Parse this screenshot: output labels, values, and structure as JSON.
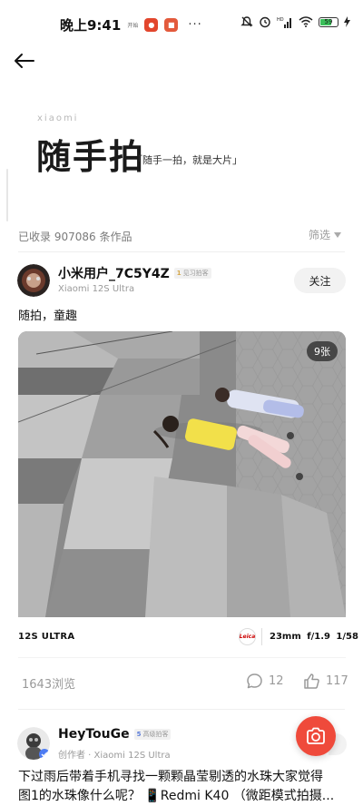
{
  "status_bar": {
    "time": "晚上9:41",
    "mini_tag": "开始",
    "more": "···",
    "network_label": "HD",
    "battery": "59",
    "colors": {
      "battery_fill": "#3bbf5a",
      "app1": "#e2462d",
      "app2": "#e35a3c"
    }
  },
  "header": {
    "brand": "xiaomi",
    "title": "随手拍",
    "slogan": "「随手一拍，就是大片」"
  },
  "toolbar": {
    "count_text": "已收录 907086 条作品",
    "filter_label": "筛选"
  },
  "post1": {
    "username": "小米用户_7C5Y4Z",
    "badge_level": "1",
    "badge_text": "见习拍客",
    "device": "Xiaomi 12S Ultra",
    "follow_label": "关注",
    "caption": "随拍，童趣",
    "photo_count": "9张",
    "exif_model": "12S ULTRA",
    "leica": "Leica",
    "exif_params": "23mm  f/1.9  1/58",
    "views": "1643浏览",
    "comments": "12",
    "likes": "117"
  },
  "post2": {
    "username": "HeyTouGe",
    "badge_level": "5",
    "badge_text": "高级拍客",
    "device": "创作者 · Xiaomi 12S Ultra",
    "text_line1": "下过雨后带着手机寻找一颗颗晶莹剔透的水珠大家觉得",
    "text_line2": "图1的水珠像什么呢？ 📱Redmi K40 （微距模式拍摄..."
  },
  "colors": {
    "accent": "#ef4a3b",
    "text": "#111111",
    "muted": "#9a9a9a"
  }
}
